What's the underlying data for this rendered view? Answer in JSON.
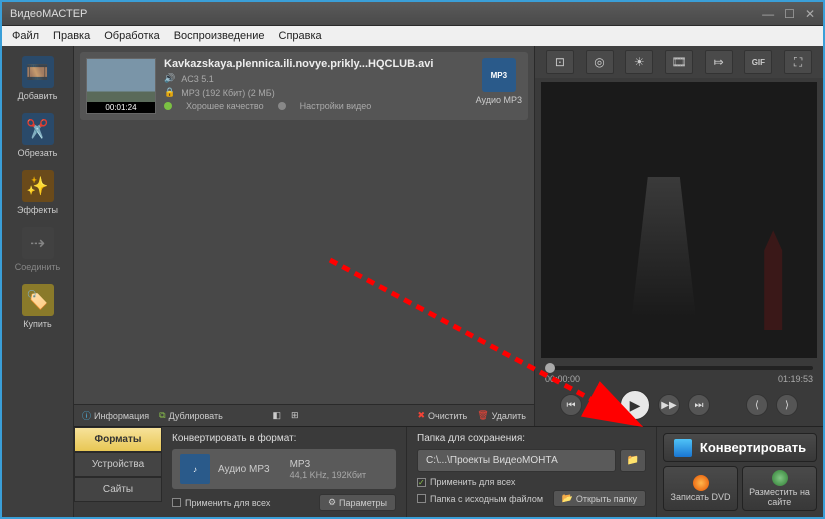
{
  "window": {
    "title": "ВидеоМАСТЕР"
  },
  "menu": {
    "file": "Файл",
    "edit": "Правка",
    "process": "Обработка",
    "play": "Воспроизведение",
    "help": "Справка"
  },
  "sidebar": {
    "add": "Добавить",
    "trim": "Обрезать",
    "effects": "Эффекты",
    "join": "Соединить",
    "buy": "Купить"
  },
  "file": {
    "name": "Kavkazskaya.plennica.ili.novye.prikly...HQCLUB.avi",
    "duration": "00:01:24",
    "audio": "AC3 5.1",
    "bitrate": "MP3 (192 Кбит) (2 МБ)",
    "quality": "Хорошее качество",
    "settings": "Настройки видео",
    "format_label": "Аудио MP3",
    "format_badge": "MP3"
  },
  "actions": {
    "info": "Информация",
    "dup": "Дублировать",
    "clear": "Очистить",
    "delete": "Удалить"
  },
  "preview": {
    "start_time": "00:00:00",
    "end_time": "01:19:53"
  },
  "tabs": {
    "formats": "Форматы",
    "devices": "Устройства",
    "sites": "Сайты"
  },
  "format_section": {
    "title": "Конвертировать в формат:",
    "name": "Аудио MP3",
    "codec": "MP3",
    "params": "44,1 KHz, 192Кбит",
    "apply_all": "Применить для всех",
    "parameters": "Параметры"
  },
  "folder_section": {
    "title": "Папка для сохранения:",
    "path": "C:\\...\\Проекты ВидеоМОНТА",
    "apply_all": "Применить для всех",
    "source_folder": "Папка с исходным файлом",
    "open_folder": "Открыть папку"
  },
  "convert": {
    "label": "Конвертировать",
    "burn_dvd": "Записать DVD",
    "upload": "Разместить на сайте"
  }
}
